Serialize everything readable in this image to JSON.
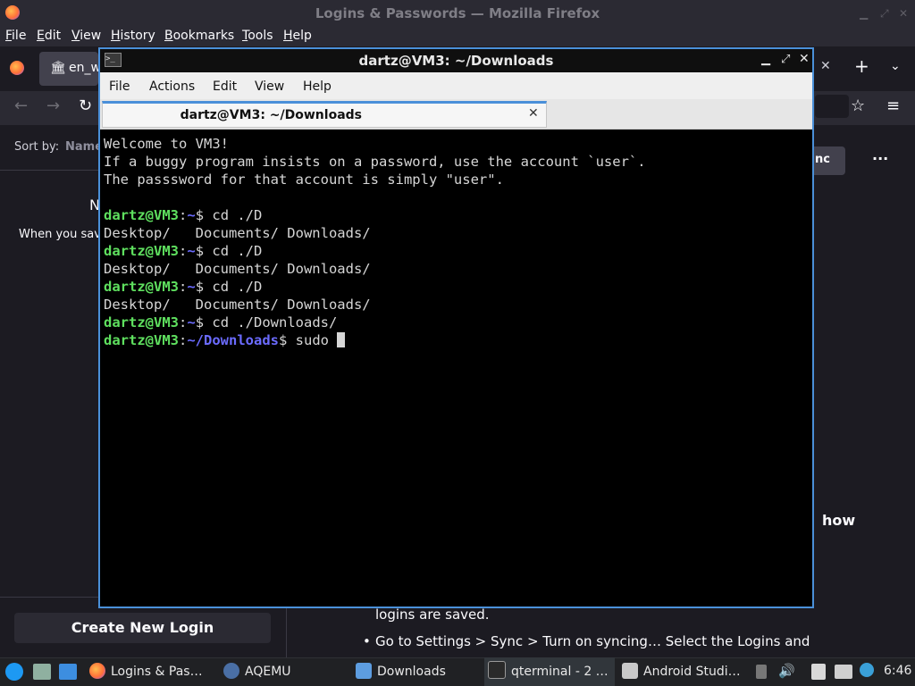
{
  "firefox": {
    "title": "Logins & Passwords — Mozilla Firefox",
    "menu": [
      {
        "underline": "F",
        "rest": "ile"
      },
      {
        "underline": "E",
        "rest": "dit"
      },
      {
        "underline": "V",
        "rest": "iew"
      },
      {
        "underline": "H",
        "rest": "istory"
      },
      {
        "underline": "B",
        "rest": "ookmarks"
      },
      {
        "underline": "T",
        "rest": "ools"
      },
      {
        "underline": "H",
        "rest": "elp"
      }
    ],
    "tab_partial": "en_w",
    "sort_label": "Sort by:",
    "sort_value": "Name",
    "sidebar_heading_partial": "N",
    "sidebar_text_partial": "When you sav",
    "sync_partial": "nc",
    "more_menu": "···",
    "content_heading_partial": "how",
    "content_line_partial": "logins are saved.",
    "content_bullet": "Go to Settings > Sync > Turn on syncing… Select the Logins and",
    "create_login_label": "Create New Login"
  },
  "terminal": {
    "title": "dartz@VM3: ~/Downloads",
    "menu": [
      "File",
      "Actions",
      "Edit",
      "View",
      "Help"
    ],
    "tab_label": "dartz@VM3: ~/Downloads",
    "lines": {
      "l1": "Welcome to VM3!",
      "l2": "If a buggy program insists on a password, use the account `user`.",
      "l3": "The passsword for that account is simply \"user\".",
      "prompt_user": "dartz@VM3",
      "colon": ":",
      "tilde": "~",
      "dollar": "$ ",
      "cmd1": "cd ./D",
      "out1": "Desktop/   Documents/ Downloads/",
      "cmd4": "cd ./Downloads/",
      "path_dl": "~/Downloads",
      "cmd5": "sudo "
    }
  },
  "taskbar": {
    "items": [
      "Logins & Pas…",
      "AQEMU",
      "Downloads",
      "qterminal - 2 …",
      "Android Studi…"
    ],
    "clock": "6:46"
  },
  "colors": {
    "accent": "#4a90d9",
    "prompt_user": "#5fe05f",
    "prompt_path": "#6b6bff"
  }
}
